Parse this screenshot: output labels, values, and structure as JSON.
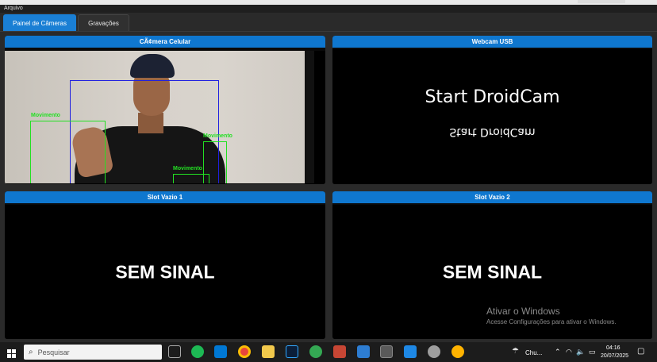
{
  "menubar": {
    "file_menu": "Arquivo"
  },
  "tabs": [
    {
      "label": "Painel de Câmeras",
      "active": true
    },
    {
      "label": "Gravações",
      "active": false
    }
  ],
  "panels": {
    "cam1": {
      "title": "CÃ¢mera Celular"
    },
    "cam2": {
      "title": "Webcam USB",
      "text_line1": "Start DroidCam",
      "text_line2": "Start DroidCam"
    },
    "slot1": {
      "title": "Slot Vazio 1",
      "status": "SEM SINAL"
    },
    "slot2": {
      "title": "Slot Vazio 2",
      "status": "SEM SINAL"
    }
  },
  "detections": [
    {
      "label": "Movimento"
    },
    {
      "label": "Movimento"
    },
    {
      "label": "Movimento"
    }
  ],
  "watermark": {
    "line1": "Ativar o Windows",
    "line2": "Acesse Configurações para ativar o Windows."
  },
  "taskbar": {
    "search_placeholder": "Pesquisar",
    "weather_text": "Chu...",
    "time": "04:16",
    "date": "20/07/2025"
  },
  "colors": {
    "accent": "#0f77cf",
    "detection_green": "#23e023",
    "detection_blue": "#1f1fe0"
  }
}
